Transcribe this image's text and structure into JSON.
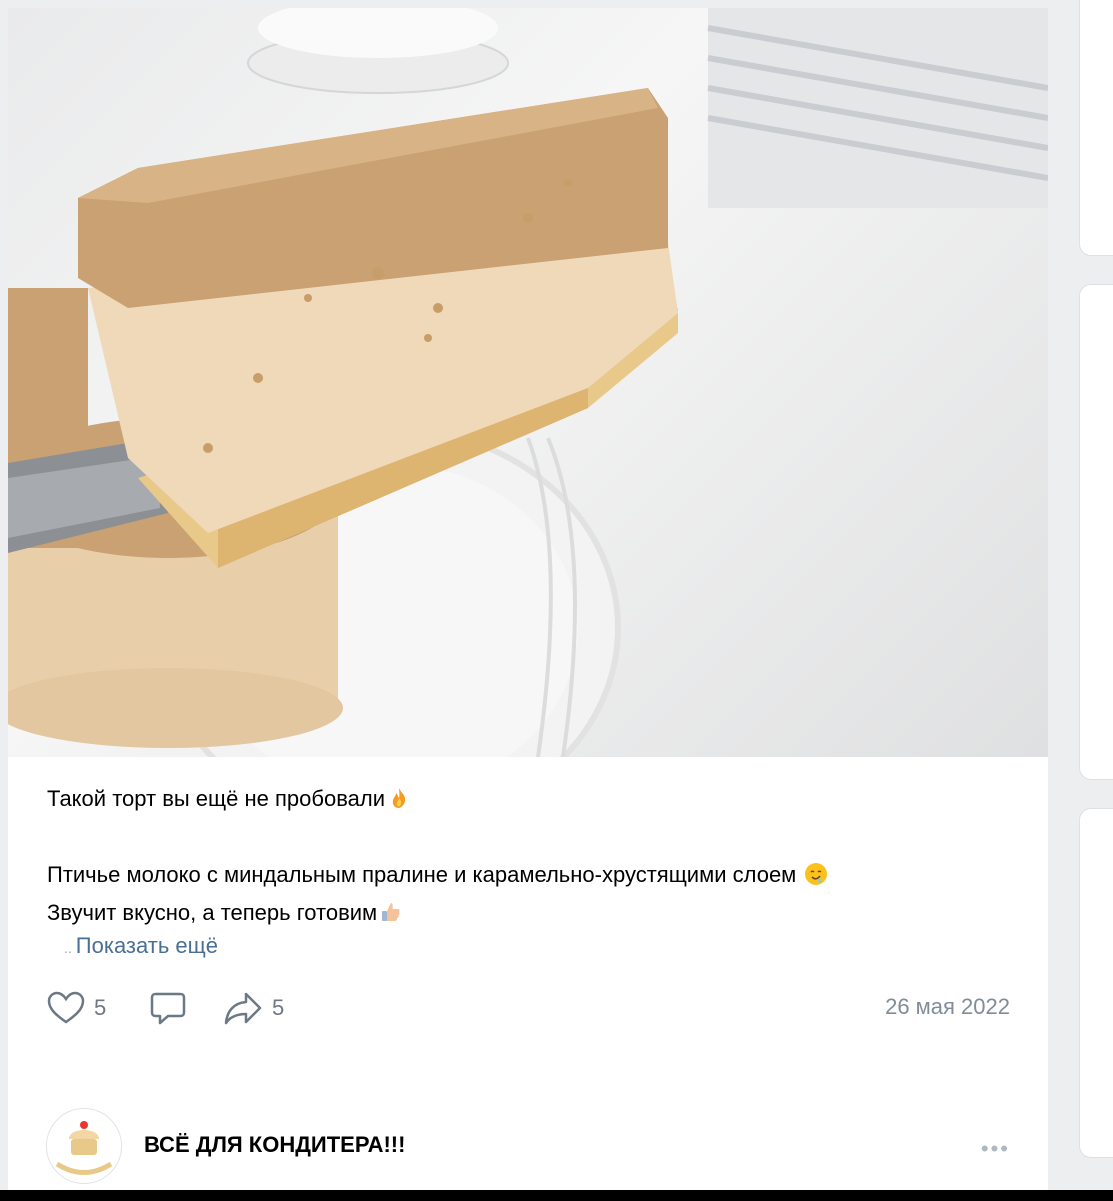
{
  "post": {
    "photo_alt": "cake-slice-photo",
    "text_line_1": "Такой торт вы ещё не пробовали",
    "text_line_2": "Птичье молоко с миндальным пралине и карамельно-хрустящими слоем",
    "text_line_3": "Звучит вкусно, а теперь готовим",
    "show_more": "Показать ещё",
    "show_more_prefix": "..",
    "likes": "5",
    "shares": "5",
    "date": "26 мая 2022"
  },
  "next_post": {
    "author": "ВСЁ ДЛЯ КОНДИТЕРА!!!",
    "more": "•••"
  },
  "icons": {
    "like": "heart-icon",
    "comment": "comment-icon",
    "share": "share-icon",
    "fire": "fire-emoji",
    "drool": "drooling-face-emoji",
    "thumbs": "thumbs-up-emoji"
  },
  "colors": {
    "link": "#4a6f94",
    "meta": "#818c99",
    "caramel": "#c9a173"
  }
}
